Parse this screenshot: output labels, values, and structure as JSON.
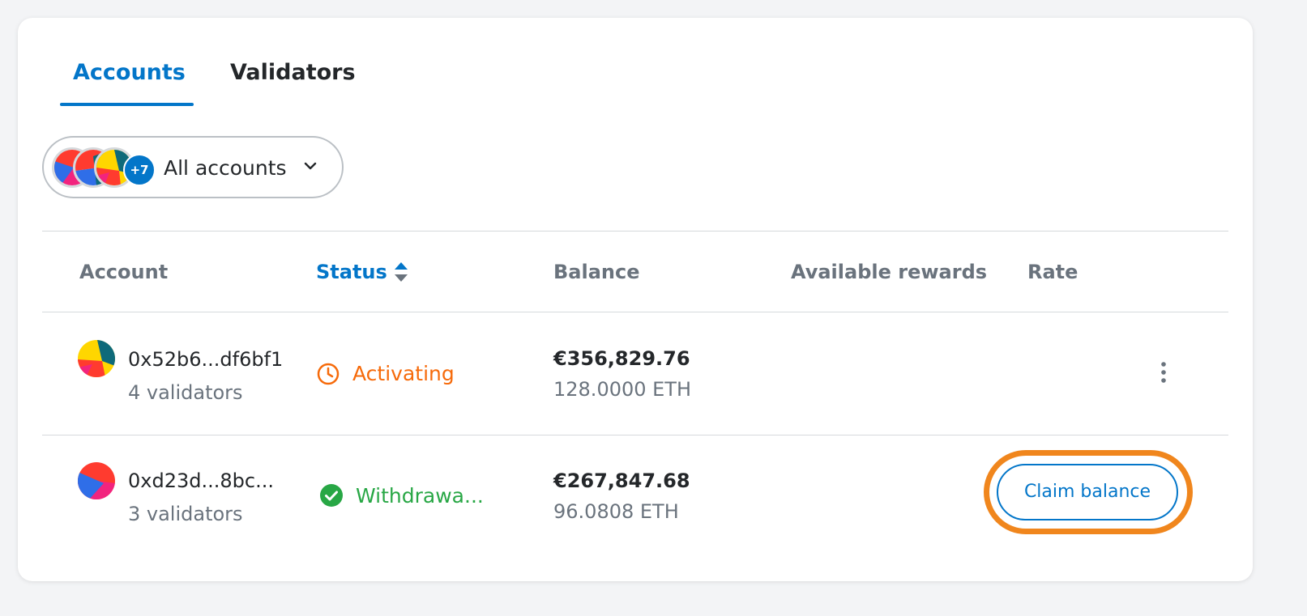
{
  "tabs": {
    "accounts": "Accounts",
    "validators": "Validators"
  },
  "account_picker": {
    "label": "All accounts",
    "extra_count": "+7"
  },
  "table": {
    "headers": {
      "account": "Account",
      "status": "Status",
      "balance": "Balance",
      "rewards": "Available rewards",
      "rate": "Rate"
    },
    "rows": [
      {
        "address": "0x52b6...df6bf1",
        "validators": "4 validators",
        "status": "Activating",
        "status_icon": "clock-icon",
        "status_color": "#f66a0a",
        "fiat": "€356,829.76",
        "eth": "128.0000 ETH"
      },
      {
        "address": "0xd23d...8bc...",
        "validators": "3 validators",
        "status": "Withdrawa...",
        "status_icon": "check-circle-icon",
        "status_color": "#28a745",
        "fiat": "€267,847.68",
        "eth": "96.0808 ETH",
        "action": "Claim balance"
      }
    ]
  },
  "colors": {
    "accent": "#0376c9",
    "highlight": "#f0861d",
    "text": "#24272a",
    "muted": "#6a737d"
  }
}
